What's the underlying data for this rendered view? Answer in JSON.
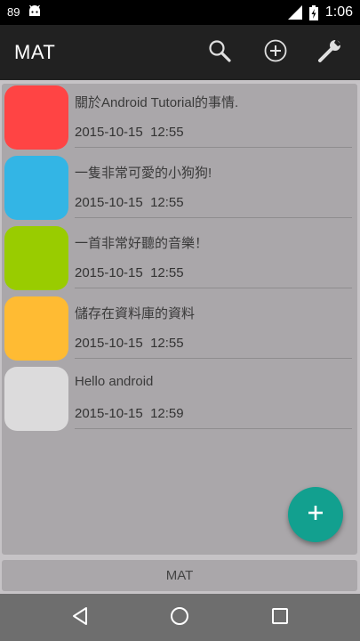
{
  "status_bar": {
    "battery_percent": "89",
    "time": "1:06",
    "icons": [
      "android-notification-icon",
      "signal-icon",
      "battery-charging-icon"
    ]
  },
  "app_bar": {
    "title": "MAT",
    "actions": [
      "search-icon",
      "add-circle-icon",
      "wrench-icon"
    ]
  },
  "items": [
    {
      "title": "關於Android Tutorial的事情.",
      "date": "2015-10-15  12:55",
      "color": "#ff4444"
    },
    {
      "title": "一隻非常可愛的小狗狗!",
      "date": "2015-10-15  12:55",
      "color": "#33b5e5"
    },
    {
      "title": "一首非常好聽的音樂！",
      "date": "2015-10-15  12:55",
      "color": "#99cc00"
    },
    {
      "title": "儲存在資料庫的資料",
      "date": "2015-10-15  12:55",
      "color": "#ffbb33"
    },
    {
      "title": "Hello android",
      "date": "2015-10-15  12:59",
      "color": "#dcdbdc"
    }
  ],
  "fab": {
    "icon": "plus-icon",
    "color": "#12a08f"
  },
  "bottom_bar": {
    "label": "MAT"
  },
  "nav_bar": {
    "buttons": [
      "back-icon",
      "home-icon",
      "recents-icon"
    ]
  }
}
